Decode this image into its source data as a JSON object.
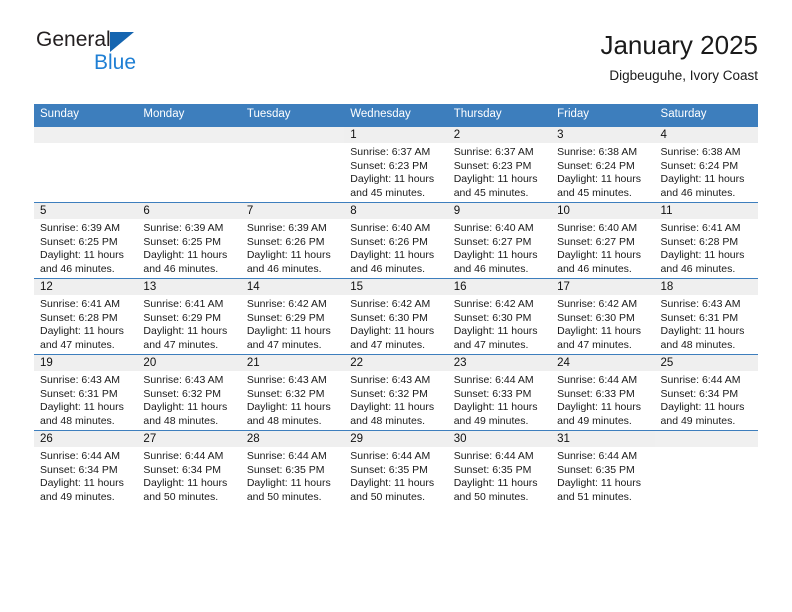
{
  "brand": {
    "name_part1": "General",
    "name_part2": "Blue",
    "logo_icon": "triangle-flag-icon",
    "accent_color": "#1f7fd4",
    "triangle_color": "#1565b0"
  },
  "header": {
    "title": "January 2025",
    "subtitle": "Digbeuguhe, Ivory Coast"
  },
  "calendar": {
    "header_bg": "#3d7ebd",
    "header_text_color": "#ffffff",
    "daystrip_bg": "#efefef",
    "weekday_headers": [
      "Sunday",
      "Monday",
      "Tuesday",
      "Wednesday",
      "Thursday",
      "Friday",
      "Saturday"
    ],
    "weeks": [
      [
        {
          "day": "",
          "sunrise": "",
          "sunset": "",
          "daylight1": "",
          "daylight2": ""
        },
        {
          "day": "",
          "sunrise": "",
          "sunset": "",
          "daylight1": "",
          "daylight2": ""
        },
        {
          "day": "",
          "sunrise": "",
          "sunset": "",
          "daylight1": "",
          "daylight2": ""
        },
        {
          "day": "1",
          "sunrise": "Sunrise: 6:37 AM",
          "sunset": "Sunset: 6:23 PM",
          "daylight1": "Daylight: 11 hours",
          "daylight2": "and 45 minutes."
        },
        {
          "day": "2",
          "sunrise": "Sunrise: 6:37 AM",
          "sunset": "Sunset: 6:23 PM",
          "daylight1": "Daylight: 11 hours",
          "daylight2": "and 45 minutes."
        },
        {
          "day": "3",
          "sunrise": "Sunrise: 6:38 AM",
          "sunset": "Sunset: 6:24 PM",
          "daylight1": "Daylight: 11 hours",
          "daylight2": "and 45 minutes."
        },
        {
          "day": "4",
          "sunrise": "Sunrise: 6:38 AM",
          "sunset": "Sunset: 6:24 PM",
          "daylight1": "Daylight: 11 hours",
          "daylight2": "and 46 minutes."
        }
      ],
      [
        {
          "day": "5",
          "sunrise": "Sunrise: 6:39 AM",
          "sunset": "Sunset: 6:25 PM",
          "daylight1": "Daylight: 11 hours",
          "daylight2": "and 46 minutes."
        },
        {
          "day": "6",
          "sunrise": "Sunrise: 6:39 AM",
          "sunset": "Sunset: 6:25 PM",
          "daylight1": "Daylight: 11 hours",
          "daylight2": "and 46 minutes."
        },
        {
          "day": "7",
          "sunrise": "Sunrise: 6:39 AM",
          "sunset": "Sunset: 6:26 PM",
          "daylight1": "Daylight: 11 hours",
          "daylight2": "and 46 minutes."
        },
        {
          "day": "8",
          "sunrise": "Sunrise: 6:40 AM",
          "sunset": "Sunset: 6:26 PM",
          "daylight1": "Daylight: 11 hours",
          "daylight2": "and 46 minutes."
        },
        {
          "day": "9",
          "sunrise": "Sunrise: 6:40 AM",
          "sunset": "Sunset: 6:27 PM",
          "daylight1": "Daylight: 11 hours",
          "daylight2": "and 46 minutes."
        },
        {
          "day": "10",
          "sunrise": "Sunrise: 6:40 AM",
          "sunset": "Sunset: 6:27 PM",
          "daylight1": "Daylight: 11 hours",
          "daylight2": "and 46 minutes."
        },
        {
          "day": "11",
          "sunrise": "Sunrise: 6:41 AM",
          "sunset": "Sunset: 6:28 PM",
          "daylight1": "Daylight: 11 hours",
          "daylight2": "and 46 minutes."
        }
      ],
      [
        {
          "day": "12",
          "sunrise": "Sunrise: 6:41 AM",
          "sunset": "Sunset: 6:28 PM",
          "daylight1": "Daylight: 11 hours",
          "daylight2": "and 47 minutes."
        },
        {
          "day": "13",
          "sunrise": "Sunrise: 6:41 AM",
          "sunset": "Sunset: 6:29 PM",
          "daylight1": "Daylight: 11 hours",
          "daylight2": "and 47 minutes."
        },
        {
          "day": "14",
          "sunrise": "Sunrise: 6:42 AM",
          "sunset": "Sunset: 6:29 PM",
          "daylight1": "Daylight: 11 hours",
          "daylight2": "and 47 minutes."
        },
        {
          "day": "15",
          "sunrise": "Sunrise: 6:42 AM",
          "sunset": "Sunset: 6:30 PM",
          "daylight1": "Daylight: 11 hours",
          "daylight2": "and 47 minutes."
        },
        {
          "day": "16",
          "sunrise": "Sunrise: 6:42 AM",
          "sunset": "Sunset: 6:30 PM",
          "daylight1": "Daylight: 11 hours",
          "daylight2": "and 47 minutes."
        },
        {
          "day": "17",
          "sunrise": "Sunrise: 6:42 AM",
          "sunset": "Sunset: 6:30 PM",
          "daylight1": "Daylight: 11 hours",
          "daylight2": "and 47 minutes."
        },
        {
          "day": "18",
          "sunrise": "Sunrise: 6:43 AM",
          "sunset": "Sunset: 6:31 PM",
          "daylight1": "Daylight: 11 hours",
          "daylight2": "and 48 minutes."
        }
      ],
      [
        {
          "day": "19",
          "sunrise": "Sunrise: 6:43 AM",
          "sunset": "Sunset: 6:31 PM",
          "daylight1": "Daylight: 11 hours",
          "daylight2": "and 48 minutes."
        },
        {
          "day": "20",
          "sunrise": "Sunrise: 6:43 AM",
          "sunset": "Sunset: 6:32 PM",
          "daylight1": "Daylight: 11 hours",
          "daylight2": "and 48 minutes."
        },
        {
          "day": "21",
          "sunrise": "Sunrise: 6:43 AM",
          "sunset": "Sunset: 6:32 PM",
          "daylight1": "Daylight: 11 hours",
          "daylight2": "and 48 minutes."
        },
        {
          "day": "22",
          "sunrise": "Sunrise: 6:43 AM",
          "sunset": "Sunset: 6:32 PM",
          "daylight1": "Daylight: 11 hours",
          "daylight2": "and 48 minutes."
        },
        {
          "day": "23",
          "sunrise": "Sunrise: 6:44 AM",
          "sunset": "Sunset: 6:33 PM",
          "daylight1": "Daylight: 11 hours",
          "daylight2": "and 49 minutes."
        },
        {
          "day": "24",
          "sunrise": "Sunrise: 6:44 AM",
          "sunset": "Sunset: 6:33 PM",
          "daylight1": "Daylight: 11 hours",
          "daylight2": "and 49 minutes."
        },
        {
          "day": "25",
          "sunrise": "Sunrise: 6:44 AM",
          "sunset": "Sunset: 6:34 PM",
          "daylight1": "Daylight: 11 hours",
          "daylight2": "and 49 minutes."
        }
      ],
      [
        {
          "day": "26",
          "sunrise": "Sunrise: 6:44 AM",
          "sunset": "Sunset: 6:34 PM",
          "daylight1": "Daylight: 11 hours",
          "daylight2": "and 49 minutes."
        },
        {
          "day": "27",
          "sunrise": "Sunrise: 6:44 AM",
          "sunset": "Sunset: 6:34 PM",
          "daylight1": "Daylight: 11 hours",
          "daylight2": "and 50 minutes."
        },
        {
          "day": "28",
          "sunrise": "Sunrise: 6:44 AM",
          "sunset": "Sunset: 6:35 PM",
          "daylight1": "Daylight: 11 hours",
          "daylight2": "and 50 minutes."
        },
        {
          "day": "29",
          "sunrise": "Sunrise: 6:44 AM",
          "sunset": "Sunset: 6:35 PM",
          "daylight1": "Daylight: 11 hours",
          "daylight2": "and 50 minutes."
        },
        {
          "day": "30",
          "sunrise": "Sunrise: 6:44 AM",
          "sunset": "Sunset: 6:35 PM",
          "daylight1": "Daylight: 11 hours",
          "daylight2": "and 50 minutes."
        },
        {
          "day": "31",
          "sunrise": "Sunrise: 6:44 AM",
          "sunset": "Sunset: 6:35 PM",
          "daylight1": "Daylight: 11 hours",
          "daylight2": "and 51 minutes."
        },
        {
          "day": "",
          "sunrise": "",
          "sunset": "",
          "daylight1": "",
          "daylight2": ""
        }
      ]
    ]
  }
}
